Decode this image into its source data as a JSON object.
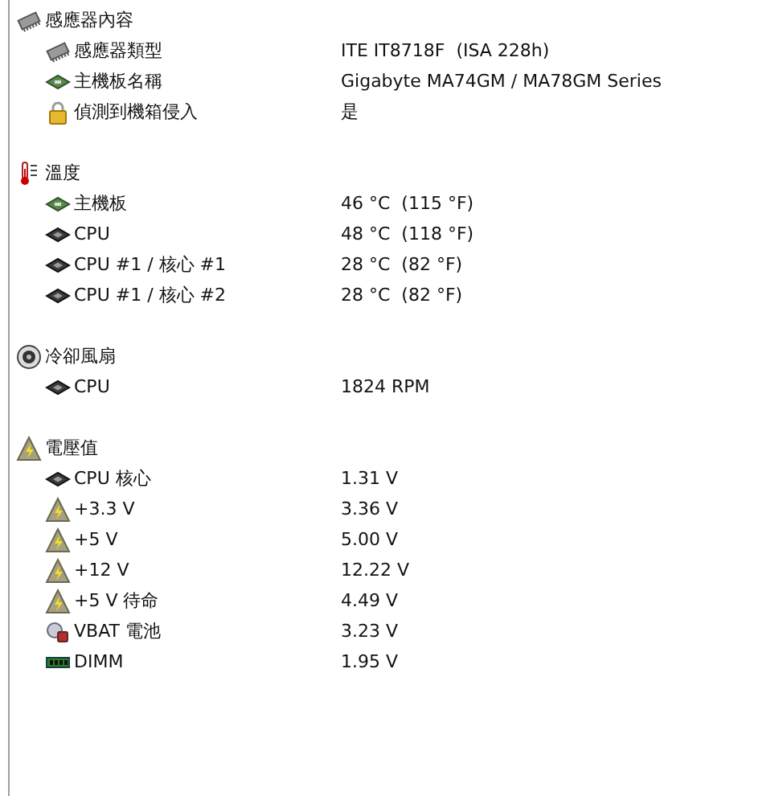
{
  "sections": [
    {
      "title": "感應器內容",
      "kind": "chip",
      "rows": [
        {
          "kind": "chip",
          "label": "感應器類型",
          "value": "ITE IT8718F  (ISA 228h)"
        },
        {
          "kind": "board",
          "label": "主機板名稱",
          "value": "Gigabyte MA74GM / MA78GM Series"
        },
        {
          "kind": "lock",
          "label": "偵測到機箱侵入",
          "value": "是"
        }
      ]
    },
    {
      "title": "溫度",
      "kind": "thermometer",
      "rows": [
        {
          "kind": "board",
          "label": "主機板",
          "value": "46 °C  (115 °F)"
        },
        {
          "kind": "cpu",
          "label": "CPU",
          "value": "48 °C  (118 °F)"
        },
        {
          "kind": "cpu",
          "label": "CPU #1 / 核心 #1",
          "value": "28 °C  (82 °F)"
        },
        {
          "kind": "cpu",
          "label": "CPU #1 / 核心 #2",
          "value": "28 °C  (82 °F)"
        }
      ]
    },
    {
      "title": "冷卻風扇",
      "kind": "fan",
      "rows": [
        {
          "kind": "cpu",
          "label": "CPU",
          "value": "1824 RPM"
        }
      ]
    },
    {
      "title": "電壓值",
      "kind": "voltage",
      "rows": [
        {
          "kind": "cpu",
          "label": "CPU 核心",
          "value": "1.31 V"
        },
        {
          "kind": "voltage",
          "label": "+3.3 V",
          "value": "3.36 V"
        },
        {
          "kind": "voltage",
          "label": "+5 V",
          "value": "5.00 V"
        },
        {
          "kind": "voltage",
          "label": "+12 V",
          "value": "12.22 V"
        },
        {
          "kind": "voltage",
          "label": "+5 V 待命",
          "value": "4.49 V"
        },
        {
          "kind": "battery",
          "label": "VBAT 電池",
          "value": "3.23 V"
        },
        {
          "kind": "dimm",
          "label": "DIMM",
          "value": "1.95 V"
        }
      ]
    }
  ]
}
